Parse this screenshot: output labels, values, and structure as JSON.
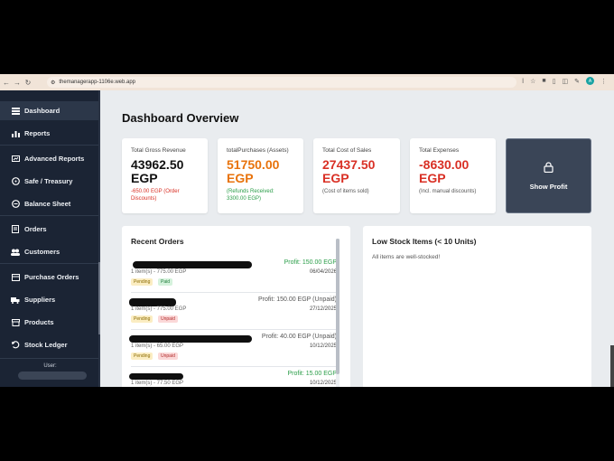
{
  "browser": {
    "url": "themanagerapp-1106e.web.app",
    "avatar_letter": "A"
  },
  "sidebar": {
    "items": [
      {
        "label": "Dashboard",
        "icon": "dashboard-icon"
      },
      {
        "label": "Reports",
        "icon": "bar-chart-icon"
      },
      {
        "label": "Advanced Reports",
        "icon": "report-icon"
      },
      {
        "label": "Safe / Treasury",
        "icon": "safe-icon"
      },
      {
        "label": "Balance Sheet",
        "icon": "scale-icon"
      },
      {
        "label": "Orders",
        "icon": "orders-icon"
      },
      {
        "label": "Customers",
        "icon": "customers-icon"
      },
      {
        "label": "Purchase Orders",
        "icon": "purchase-icon"
      },
      {
        "label": "Suppliers",
        "icon": "truck-icon"
      },
      {
        "label": "Products",
        "icon": "box-icon"
      },
      {
        "label": "Stock Ledger",
        "icon": "ledger-icon"
      }
    ],
    "user_label": "User:"
  },
  "page": {
    "title": "Dashboard Overview"
  },
  "cards": {
    "revenue": {
      "label": "Total Gross Revenue",
      "value": "43962.50",
      "unit": "EGP",
      "sub": "-650.00 EGP (Order Discounts)"
    },
    "purchases": {
      "label": "totalPurchases (Assets)",
      "value": "51750.00",
      "unit": "EGP",
      "sub": "(Refunds Received: 3300.00 EGP)"
    },
    "cost": {
      "label": "Total Cost of Sales",
      "value": "27437.50",
      "unit": "EGP",
      "sub": "(Cost of items sold)"
    },
    "expenses": {
      "label": "Total Expenses",
      "value": "-8630.00",
      "unit": "EGP",
      "sub": "(Incl. manual discounts)"
    }
  },
  "show_profit": {
    "label": "Show Profit"
  },
  "recent_orders": {
    "title": "Recent Orders",
    "orders": [
      {
        "profit": "Profit: 150.00 EGP",
        "items": "1 item(s) - 775.00 EGP",
        "date": "06/04/2026",
        "status": "Pending",
        "payment": "Paid"
      },
      {
        "profit": "Profit: 150.00 EGP (Unpaid)",
        "items": "1 item(s) - 775.00 EGP",
        "date": "27/12/2025",
        "status": "Pending",
        "payment": "Unpaid"
      },
      {
        "profit": "Profit: 40.00 EGP (Unpaid)",
        "items": "1 item(s) - 65.00 EGP",
        "date": "10/12/2025",
        "status": "Pending",
        "payment": "Unpaid"
      },
      {
        "profit": "Profit: 15.00 EGP",
        "items": "1 item(s) - 77.50 EGP",
        "date": "10/12/2025"
      }
    ]
  },
  "low_stock": {
    "title": "Low Stock Items (< 10 Units)",
    "message": "All items are well-stocked!"
  }
}
